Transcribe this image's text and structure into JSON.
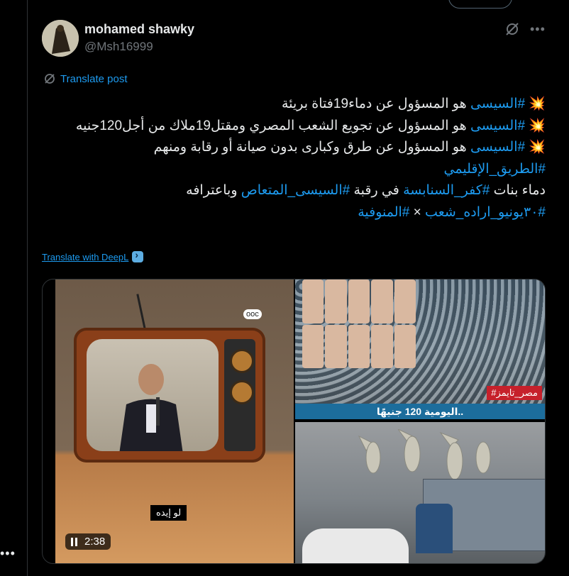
{
  "author": {
    "name": "mohamed shawky",
    "handle": "@Msh16999"
  },
  "translate_post_label": "Translate post",
  "body": {
    "line1": {
      "emoji": "💥",
      "tag": "#السيسى",
      "text": " هو المسؤول عن دماء19فتاة بريئة"
    },
    "line2": {
      "emoji": "💥",
      "tag": "#السيسى",
      "text": " هو المسؤول عن تجويع الشعب المصري ومقتل19ملاك من أجل120جنيه"
    },
    "line3": {
      "emoji": "💥",
      "tag": "#السيسى",
      "text": " هو المسؤول عن طرق وكبارى بدون صيانة أو رقابة ومنهم",
      "tag2": "#الطريق_الإقليمي"
    },
    "line4": {
      "prefix": "دماء بنات ",
      "tag1": "#كفر_السنابسة",
      "middle": " في رقبة ",
      "tag2": "#السيسى_المتعاص",
      "suffix": " وباعترافه"
    },
    "line5": {
      "tag1": "#٣٠يونيو_اراده_شعب",
      "sep": " × ",
      "tag2": "#المنوفية"
    }
  },
  "deepl_label": "Translate with DeepL",
  "video": {
    "caption": "لو إيده",
    "duration": "2:38",
    "tv_logo": "ᴏᴏᴄ"
  },
  "image_top": {
    "badge": "#مصر_تايمز",
    "headline": "اليومية 120 جنيهًا.."
  }
}
